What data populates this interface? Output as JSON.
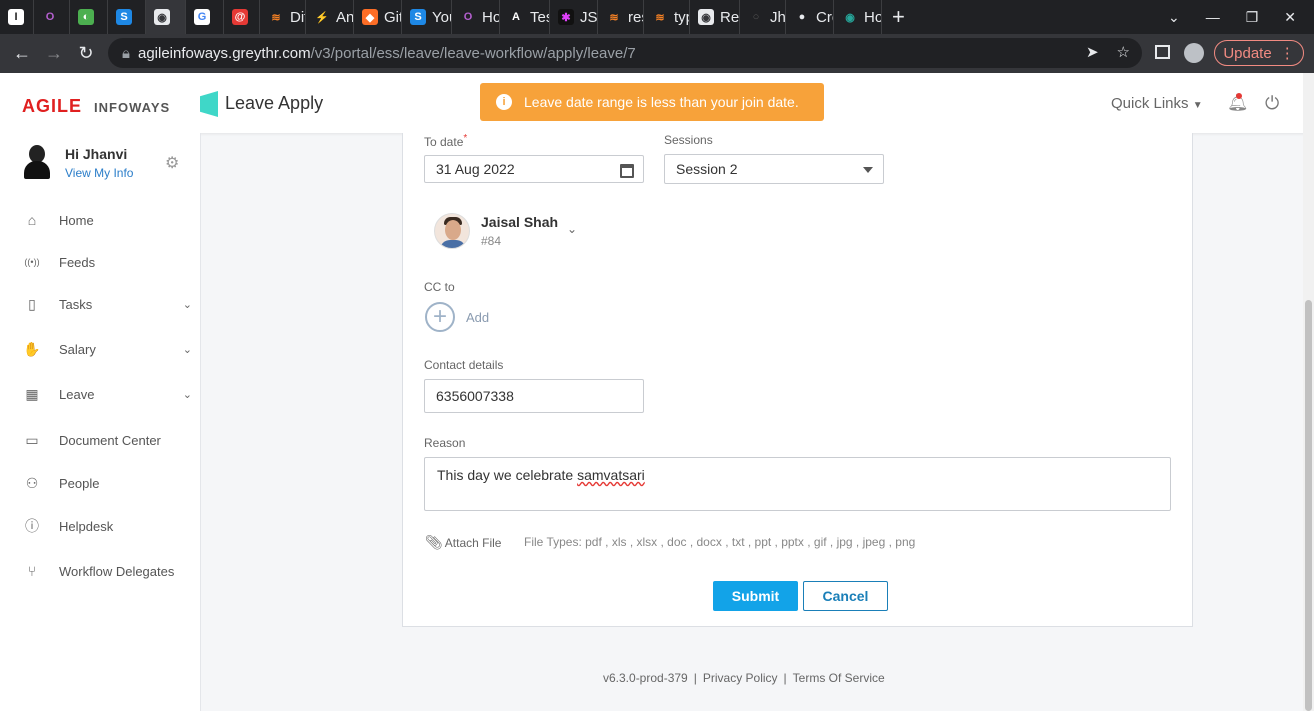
{
  "browser": {
    "tabs": [
      {
        "label": "",
        "fav_color": "#ffffff",
        "fav_text": "I",
        "fav_fg": "#222"
      },
      {
        "label": "",
        "fav_color": "#202124",
        "fav_text": "O",
        "fav_fg": "#b45fcf"
      },
      {
        "label": "",
        "fav_color": "#4caf50",
        "fav_text": "◐",
        "fav_fg": "#fff"
      },
      {
        "label": "",
        "fav_color": "#1e88e5",
        "fav_text": "S",
        "fav_fg": "#fff"
      },
      {
        "label": "",
        "fav_color": "#e8eaed",
        "fav_text": "◉",
        "fav_fg": "#35363a",
        "active": true
      },
      {
        "label": "",
        "fav_color": "#ffffff",
        "fav_text": "G",
        "fav_fg": "#4285f4"
      },
      {
        "label": "",
        "fav_color": "#e53935",
        "fav_text": "@",
        "fav_fg": "#fff"
      },
      {
        "label": "Dif",
        "fav_color": "#202124",
        "fav_text": "≋",
        "fav_fg": "#f48024"
      },
      {
        "label": "An",
        "fav_color": "#202124",
        "fav_text": "⚡",
        "fav_fg": "#2684ff"
      },
      {
        "label": "Git",
        "fav_color": "#fc6d26",
        "fav_text": "◆",
        "fav_fg": "#fff"
      },
      {
        "label": "You",
        "fav_color": "#1e88e5",
        "fav_text": "S",
        "fav_fg": "#fff"
      },
      {
        "label": "Ho",
        "fav_color": "#202124",
        "fav_text": "O",
        "fav_fg": "#b45fcf"
      },
      {
        "label": "Tes",
        "fav_color": "#202124",
        "fav_text": "A",
        "fav_fg": "#fff"
      },
      {
        "label": "JSC",
        "fav_color": "#111111",
        "fav_text": "✱",
        "fav_fg": "#e040fb"
      },
      {
        "label": "res",
        "fav_color": "#202124",
        "fav_text": "≋",
        "fav_fg": "#f48024"
      },
      {
        "label": "typ",
        "fav_color": "#202124",
        "fav_text": "≋",
        "fav_fg": "#f48024"
      },
      {
        "label": "Rea",
        "fav_color": "#e8eaed",
        "fav_text": "◉",
        "fav_fg": "#35363a"
      },
      {
        "label": "Jha",
        "fav_color": "#202124",
        "fav_text": "○",
        "fav_fg": "#555"
      },
      {
        "label": "Cre",
        "fav_color": "#202124",
        "fav_text": "●",
        "fav_fg": "#e8eaed"
      },
      {
        "label": "Ho",
        "fav_color": "#202124",
        "fav_text": "◉",
        "fav_fg": "#26a69a"
      }
    ],
    "url_host": "agileinfoways.greythr.com",
    "url_path": "/v3/portal/ess/leave/leave-workflow/apply/leave/7",
    "update_label": "Update"
  },
  "header": {
    "logo_main": "AGILE",
    "logo_sub": "INFOWAYS",
    "page_title": "Leave Apply",
    "toast_text": "Leave date range is less than your join date.",
    "quick_links": "Quick Links"
  },
  "user": {
    "greeting": "Hi Jhanvi",
    "view_info": "View My Info"
  },
  "nav": {
    "items": [
      {
        "label": "Home",
        "icon": "home-icon"
      },
      {
        "label": "Feeds",
        "icon": "feeds-icon"
      },
      {
        "label": "Tasks",
        "icon": "clipboard-icon",
        "chevron": true
      },
      {
        "label": "Salary",
        "icon": "salary-icon",
        "chevron": true
      },
      {
        "label": "Leave",
        "icon": "calendar-icon",
        "chevron": true
      },
      {
        "label": "Document Center",
        "icon": "book-icon"
      },
      {
        "label": "People",
        "icon": "people-icon"
      },
      {
        "label": "Helpdesk",
        "icon": "info-icon"
      },
      {
        "label": "Workflow Delegates",
        "icon": "workflow-icon"
      }
    ]
  },
  "form": {
    "to_date_label": "To date",
    "to_date_value": "31 Aug 2022",
    "sessions_label": "Sessions",
    "sessions_value": "Session 2",
    "approver_name": "Jaisal Shah",
    "approver_id": "#84",
    "cc_label": "CC to",
    "cc_add": "Add",
    "contact_label": "Contact details",
    "contact_value": "6356007338",
    "reason_label": "Reason",
    "reason_text_plain": "This day we celebrate ",
    "reason_text_misspelled": "samvatsari",
    "attach_label": "Attach File",
    "file_types": "File Types: pdf , xls , xlsx , doc , docx , txt , ppt , pptx , gif , jpg , jpeg , png",
    "submit_label": "Submit",
    "cancel_label": "Cancel"
  },
  "footer": {
    "version": "v6.3.0-prod-379",
    "privacy": "Privacy Policy",
    "terms": "Terms Of Service"
  }
}
